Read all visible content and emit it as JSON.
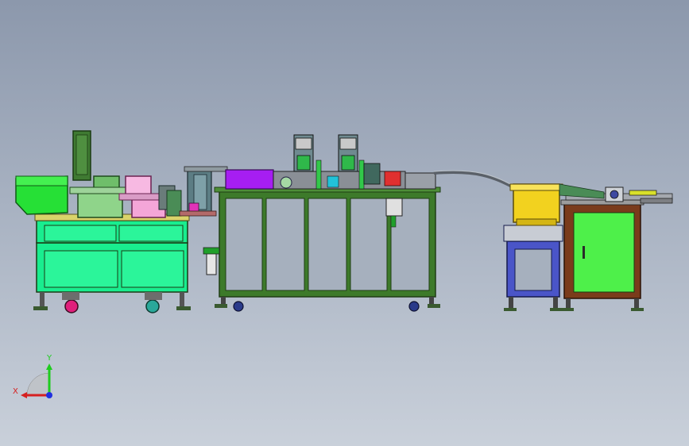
{
  "axis_triad": {
    "x_label": "X",
    "y_label": "Y"
  },
  "colors": {
    "frame_green": "#3d7a2a",
    "frame_dark": "#2a4f1d",
    "cabinet_cyan": "#19ed8f",
    "cabinet_lime": "#4ef04a",
    "feeder_gold": "#f2d21f",
    "feeder_pink": "#f4a6d8",
    "feeder_green": "#6fbe6a",
    "purple_block": "#a61ef2",
    "rail_gray": "#8a8f96",
    "brown_frame": "#7a3b1b",
    "blue_stand": "#4a55c8",
    "axis_x": "#d62020",
    "axis_y": "#1ecc1e",
    "axis_z": "#2030e0"
  },
  "components": [
    "left-vibratory-feeder-unit",
    "center-assembly-machine",
    "transfer-rail",
    "right-vibratory-feeder",
    "right-cabinet-unit",
    "coordinate-triad"
  ]
}
